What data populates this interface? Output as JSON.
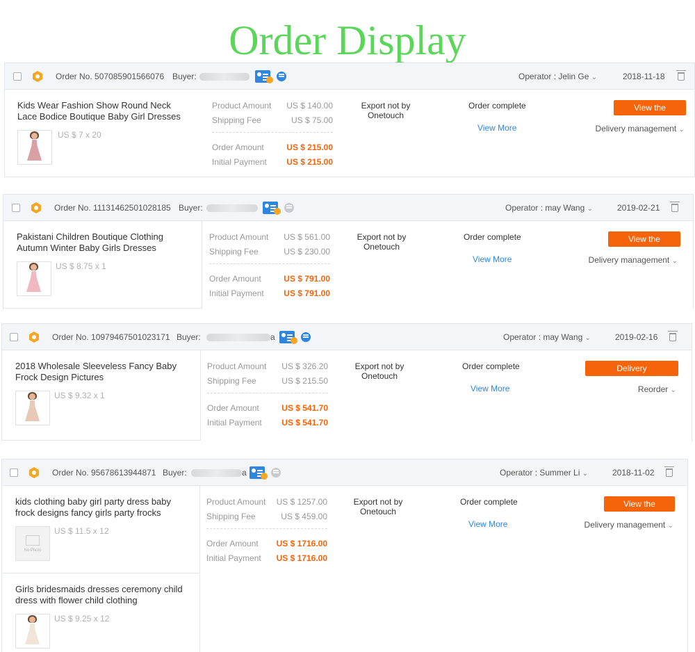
{
  "title": "Order Display",
  "labels": {
    "order_no": "Order No.",
    "buyer": "Buyer:",
    "operator": "Operator :",
    "product_amount": "Product Amount",
    "shipping_fee": "Shipping Fee",
    "order_amount": "Order Amount",
    "initial_payment": "Initial Payment",
    "export": "Export not by Onetouch",
    "status": "Order complete",
    "view_more": "View More"
  },
  "colors": {
    "title": "#5bd65b",
    "accent": "#f5640a",
    "link": "#2e86de"
  },
  "orders": [
    {
      "order_no": "507085901566076",
      "buyer_fragment": "",
      "operator": "Jelin Ge",
      "date": "2018-11-18",
      "product_amount": "US $ 140.00",
      "shipping_fee": "US $ 75.00",
      "order_amount": "US $ 215.00",
      "initial_payment": "US $ 215.00",
      "primary_button": "View the review",
      "secondary_action": "Delivery management",
      "products": [
        {
          "name": "Kids Wear Fashion Show Round Neck Lace Bodice Boutique Baby Girl Dresses",
          "unit": "US $ 7 x 20",
          "image": "pink-lace-dress"
        }
      ]
    },
    {
      "order_no": "11131462501028185",
      "buyer_fragment": "",
      "operator": "may Wang",
      "date": "2019-02-21",
      "product_amount": "US $ 561.00",
      "shipping_fee": "US $ 230.00",
      "order_amount": "US $ 791.00",
      "initial_payment": "US $ 791.00",
      "primary_button": "View the review",
      "secondary_action": "Delivery management",
      "products": [
        {
          "name": "Pakistani Children Boutique Clothing Autumn Winter Baby Girls Dresses",
          "unit": "US $ 8.75 x 1",
          "image": "pink-tulle-dress"
        }
      ]
    },
    {
      "order_no": "10979467501023171",
      "buyer_fragment": "a",
      "operator": "may Wang",
      "date": "2019-02-16",
      "product_amount": "US $ 326.20",
      "shipping_fee": "US $ 215.50",
      "order_amount": "US $ 541.70",
      "initial_payment": "US $ 541.70",
      "primary_button": "Delivery management",
      "secondary_action": "Reorder",
      "products": [
        {
          "name": "2018 Wholesale Sleeveless Fancy Baby Frock Design Pictures",
          "unit": "US $ 9.32 x 1",
          "image": "beige-frock"
        }
      ]
    },
    {
      "order_no": "95678613944871",
      "buyer_fragment": "a",
      "operator": "Summer Li",
      "date": "2018-11-02",
      "product_amount": "US $ 1257.00",
      "shipping_fee": "US $ 459.00",
      "order_amount": "US $ 1716.00",
      "initial_payment": "US $ 1716.00",
      "primary_button": "View the review",
      "secondary_action": "Delivery management",
      "products": [
        {
          "name": "kids clothing baby girl party dress baby frock designs fancy girls party frocks",
          "unit": "US $ 11.5 x 12",
          "image": "no-photo"
        },
        {
          "name": "Girls bridesmaids dresses ceremony child dress with flower child clothing",
          "unit": "US $ 9.25 x 12",
          "image": "white-bridesmaid-dress"
        }
      ]
    }
  ],
  "no_photo_text": "No Photo"
}
